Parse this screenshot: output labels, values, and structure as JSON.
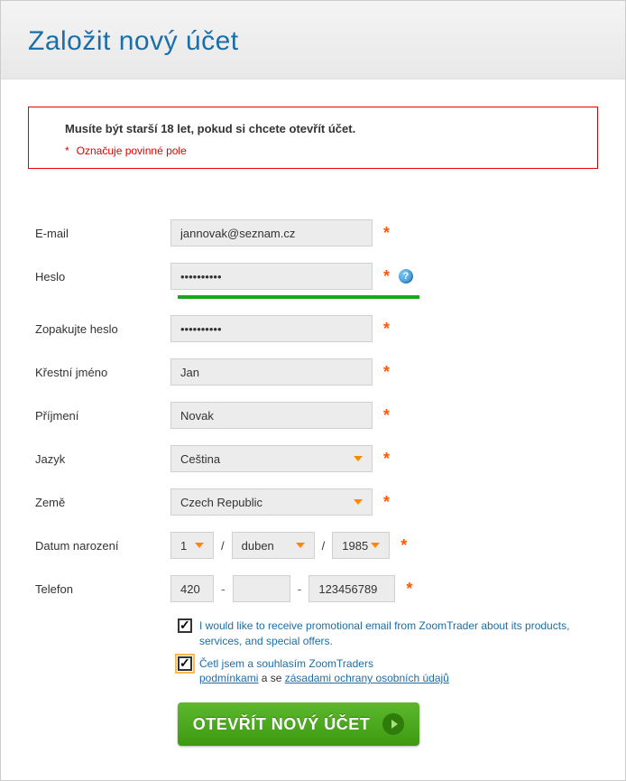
{
  "header": {
    "title": "Založit nový účet"
  },
  "alert": {
    "main": "Musíte být starší 18 let, pokud si chcete otevřít účet.",
    "required_note": "Označuje povinné pole",
    "asterisk": "*"
  },
  "form": {
    "email": {
      "label": "E-mail",
      "value": "jannovak@seznam.cz"
    },
    "password": {
      "label": "Heslo",
      "value": "••••••••••"
    },
    "password_repeat": {
      "label": "Zopakujte heslo",
      "value": "••••••••••"
    },
    "first_name": {
      "label": "Křestní jméno",
      "value": "Jan"
    },
    "last_name": {
      "label": "Příjmení",
      "value": "Novak"
    },
    "language": {
      "label": "Jazyk",
      "value": "Ceština"
    },
    "country": {
      "label": "Země",
      "value": "Czech Republic"
    },
    "dob": {
      "label": "Datum narození",
      "day": "1",
      "month": "duben",
      "year": "1985",
      "sep": "/"
    },
    "phone": {
      "label": "Telefon",
      "cc": "420",
      "area": "",
      "number": "123456789",
      "sep": "-"
    }
  },
  "checks": {
    "promo": {
      "checked": true,
      "text": "I would like to receive promotional email from ZoomTrader about its products, services, and special offers."
    },
    "terms": {
      "checked": true,
      "prefix": "Četl jsem a souhlasím ZoomTraders",
      "link1": "podmínkami",
      "mid": " a se ",
      "link2": "zásadami ochrany osobních údajů"
    }
  },
  "submit": {
    "label": "OTEVŘÍT NOVÝ ÚČET"
  },
  "symbols": {
    "help": "?"
  }
}
